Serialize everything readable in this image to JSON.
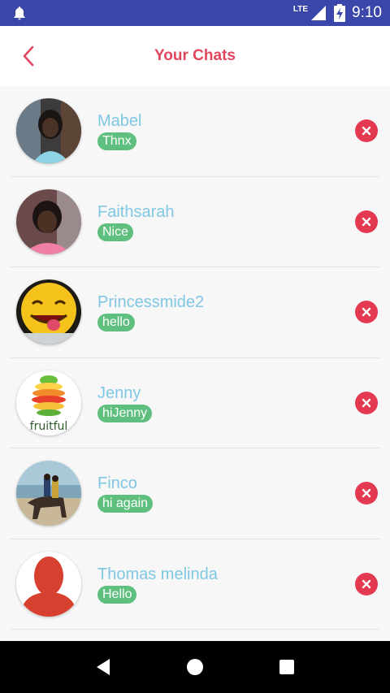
{
  "status_bar": {
    "network": "LTE",
    "time": "9:10",
    "icons": [
      "notification-bell-icon",
      "signal-icon",
      "battery-charging-icon"
    ]
  },
  "header": {
    "title": "Your Chats",
    "back_icon": "chevron-left-icon",
    "accent_color": "#e0465e"
  },
  "chats": [
    {
      "name": "Mabel",
      "message": "Thnx"
    },
    {
      "name": "Faithsarah",
      "message": "Nice"
    },
    {
      "name": "Princessmide2",
      "message": "hello"
    },
    {
      "name": "Jenny",
      "message": "hiJenny",
      "avatar_text": "fruitful"
    },
    {
      "name": "Finco",
      "message": "hi again"
    },
    {
      "name": "Thomas melinda",
      "message": "Hello"
    }
  ],
  "colors": {
    "status_bar": "#3a46a9",
    "name_text": "#7fc7e3",
    "message_badge": "#5fbf7e",
    "delete_button": "#e33a52"
  },
  "nav_bar": {
    "icons": [
      "back-triangle-icon",
      "home-circle-icon",
      "recents-square-icon"
    ]
  }
}
